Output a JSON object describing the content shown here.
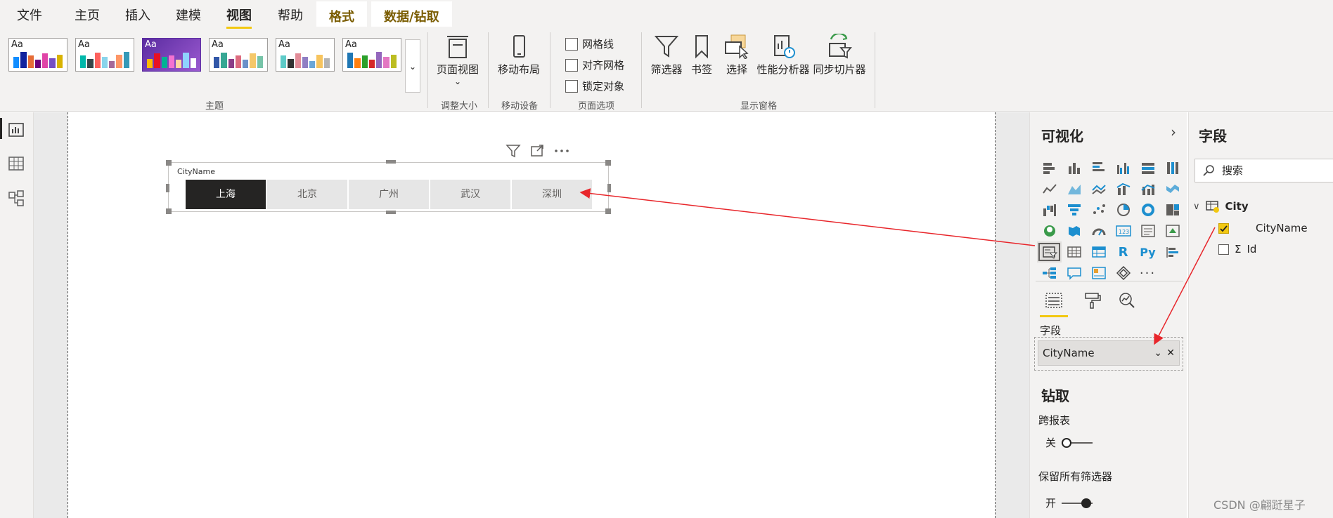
{
  "menu": {
    "items": [
      "文件",
      "主页",
      "插入",
      "建模",
      "视图",
      "帮助"
    ],
    "active": "视图",
    "context_tabs": [
      "格式",
      "数据/钻取"
    ]
  },
  "ribbon": {
    "themes_label": "主题",
    "page_view": "页面视图",
    "page_view_group": "调整大小",
    "mobile_layout": "移动布局",
    "mobile_group": "移动设备",
    "options": [
      "网格线",
      "对齐网格",
      "锁定对象"
    ],
    "options_group": "页面选项",
    "show_pane_buttons": [
      "筛选器",
      "书签",
      "选择",
      "性能分析器",
      "同步切片器"
    ],
    "show_pane_group": "显示窗格",
    "theme_swatch_label": "Aa"
  },
  "slicer": {
    "title": "CityName",
    "buttons": [
      "上海",
      "北京",
      "广州",
      "武汉",
      "深圳"
    ],
    "selected": "上海"
  },
  "viz": {
    "title": "可视化",
    "fields_label": "字段",
    "field_pill": "CityName",
    "drill_title": "钻取",
    "cross_report": "跨报表",
    "cross_report_state": "关",
    "keep_filters": "保留所有筛选器",
    "keep_filters_state": "开"
  },
  "fields": {
    "title": "字段",
    "search_placeholder": "搜索",
    "table": "City",
    "columns": [
      {
        "name": "CityName",
        "checked": true,
        "sigma": false
      },
      {
        "name": "Id",
        "checked": false,
        "sigma": true
      }
    ]
  },
  "watermark": "CSDN @翩跹星子",
  "colors": {
    "accent": "#f2c811",
    "selected": "#252423",
    "arrow": "#e8262b"
  }
}
